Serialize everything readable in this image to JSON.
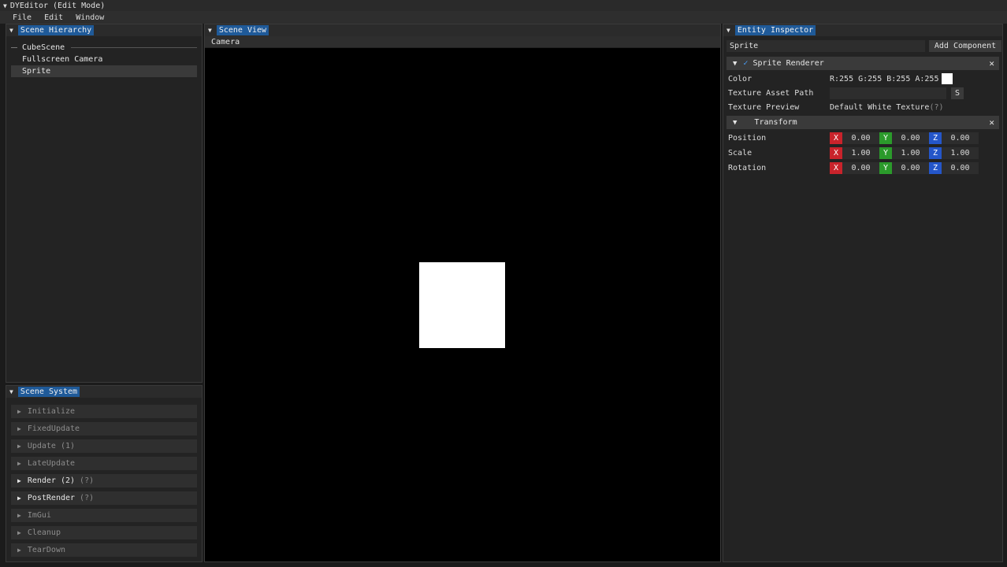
{
  "window": {
    "title": "DYEditor (Edit Mode)"
  },
  "menu": [
    "File",
    "Edit",
    "Window"
  ],
  "hierarchy": {
    "title": "Scene Hierarchy",
    "root": "CubeScene",
    "items": [
      "Fullscreen Camera",
      "Sprite"
    ]
  },
  "scene_system": {
    "title": "Scene System",
    "rows": [
      {
        "label": "Initialize",
        "hint": "",
        "active": false
      },
      {
        "label": "FixedUpdate",
        "hint": "",
        "active": false
      },
      {
        "label": "Update (1)",
        "hint": "",
        "active": false
      },
      {
        "label": "LateUpdate",
        "hint": "",
        "active": false
      },
      {
        "label": "Render (2)",
        "hint": "(?)",
        "active": true
      },
      {
        "label": "PostRender",
        "hint": "(?)",
        "active": true
      },
      {
        "label": "ImGui",
        "hint": "",
        "active": false
      },
      {
        "label": "Cleanup",
        "hint": "",
        "active": false
      },
      {
        "label": "TearDown",
        "hint": "",
        "active": false
      }
    ]
  },
  "scene_view": {
    "title": "Scene View",
    "tab": "Camera"
  },
  "inspector": {
    "title": "Entity Inspector",
    "entity_name": "Sprite",
    "add_component": "Add Component",
    "sprite_renderer": {
      "header": "Sprite Renderer",
      "color_label": "Color",
      "color_value": "R:255 G:255 B:255 A:255",
      "texture_path_label": "Texture Asset Path",
      "texture_path_value": "",
      "texture_path_button": "S",
      "texture_preview_label": "Texture Preview",
      "texture_preview_value": "Default White Texture",
      "texture_preview_hint": "(?)"
    },
    "transform": {
      "header": "Transform",
      "rows": [
        {
          "label": "Position",
          "x": "0.00",
          "y": "0.00",
          "z": "0.00"
        },
        {
          "label": "Scale",
          "x": "1.00",
          "y": "1.00",
          "z": "1.00"
        },
        {
          "label": "Rotation",
          "x": "0.00",
          "y": "0.00",
          "z": "0.00"
        }
      ],
      "axis_labels": {
        "x": "X",
        "y": "Y",
        "z": "Z"
      }
    }
  }
}
